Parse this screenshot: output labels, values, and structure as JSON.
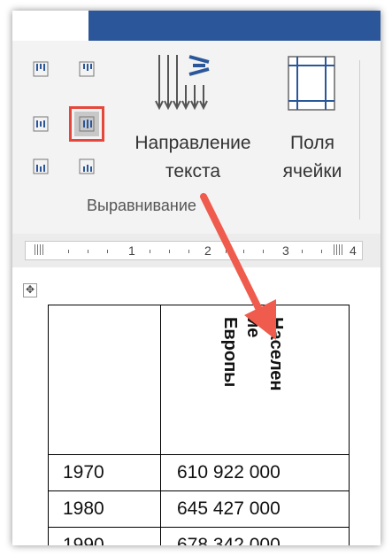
{
  "ribbon": {
    "text_direction_label_line1": "Направление",
    "text_direction_label_line2": "текста",
    "cell_margins_label_line1": "Поля",
    "cell_margins_label_line2": "ячейки",
    "group_label": "Выравнивание",
    "selected_alignment": "middle-center"
  },
  "ruler": {
    "numbers": [
      "1",
      "2",
      "3",
      "4"
    ]
  },
  "table": {
    "header": "Население Европы",
    "header_lines": [
      "Населен",
      "ие",
      "Европы"
    ],
    "rows": [
      {
        "year": "1970",
        "population": "610 922 000"
      },
      {
        "year": "1980",
        "population": "645 427 000"
      },
      {
        "year": "1990",
        "population": "678 342 000"
      }
    ]
  },
  "colors": {
    "accent_blue": "#2b579a",
    "highlight_red": "#e5473c",
    "arrow_red": "#ef5b4c"
  }
}
